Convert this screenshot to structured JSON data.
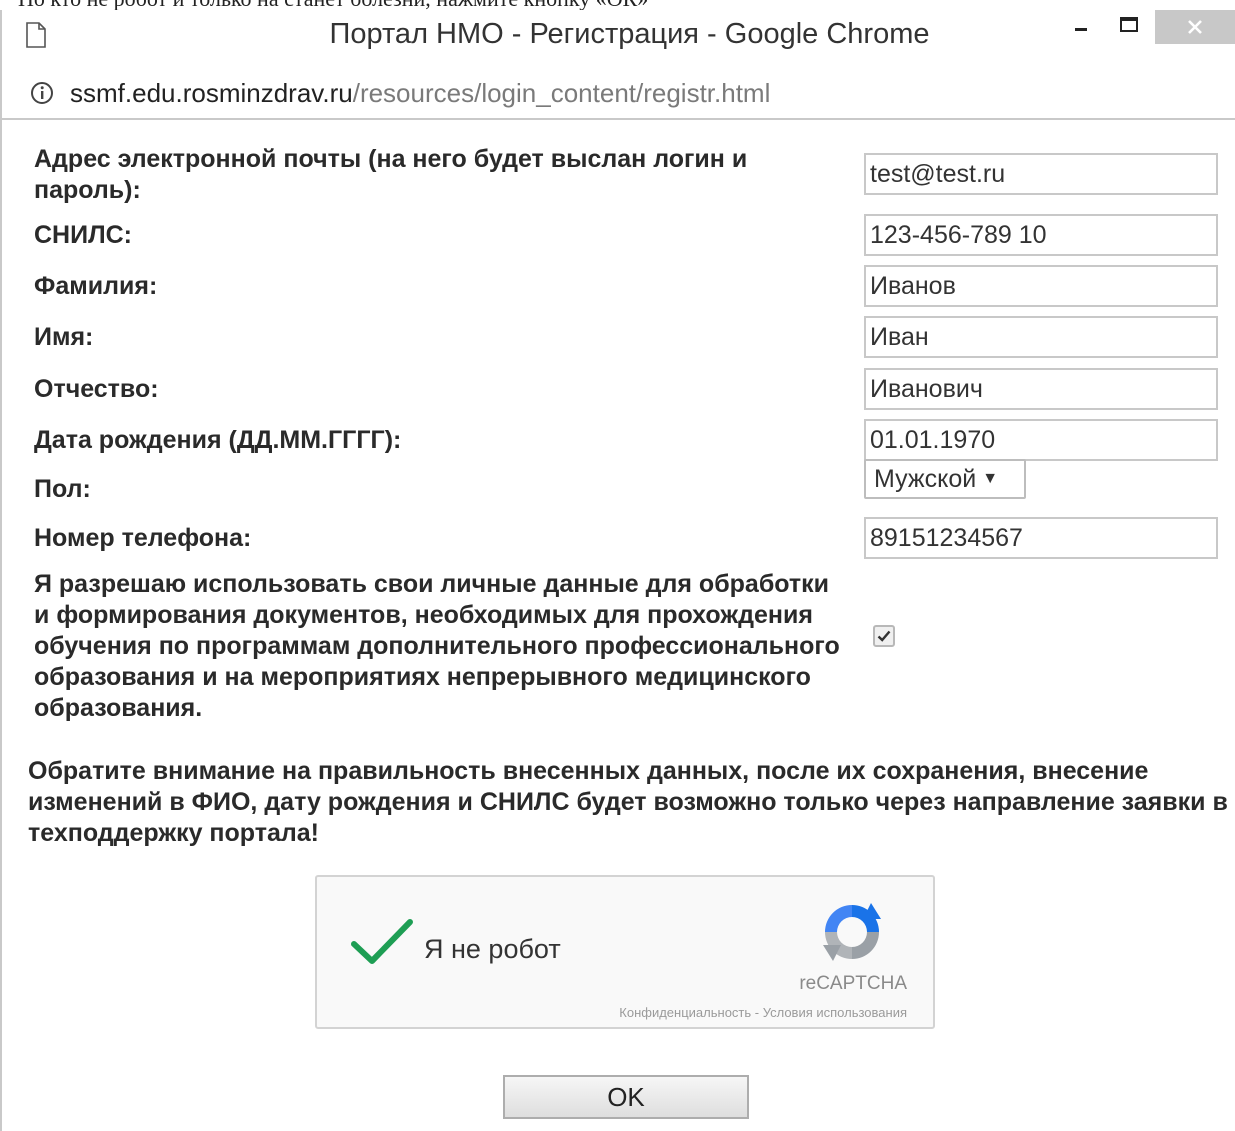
{
  "top_snippet": "Но кто не робот и только на станет болезни, нажмите кнопку «ОК»",
  "window": {
    "title": "Портал НМО - Регистрация - Google Chrome"
  },
  "address_bar": {
    "host": "ssmf.edu.rosminzdrav.ru",
    "path": "/resources/login_content/registr.html"
  },
  "form": {
    "fields": [
      {
        "label": "Адрес электронной почты (на него будет выслан логин и пароль):",
        "value": "test@test.ru"
      },
      {
        "label": "СНИЛС:",
        "value": "123-456-789 10"
      },
      {
        "label": "Фамилия:",
        "value": "Иванов"
      },
      {
        "label": "Имя:",
        "value": "Иван"
      },
      {
        "label": "Отчество:",
        "value": "Иванович"
      },
      {
        "label": "Дата рождения (ДД.ММ.ГГГГ):",
        "value": "01.01.1970"
      }
    ],
    "gender": {
      "label": "Пол:",
      "selected": "Мужской",
      "caret": "▼"
    },
    "phone": {
      "label": "Номер телефона:",
      "value": "89151234567"
    },
    "consent": {
      "text": "Я разрешаю использовать свои личные данные для обработки и формирования документов, необходимых для прохождения обучения по программам дополнительного профессионального образования и на мероприятиях непрерывного медицинского образования.",
      "checked": true
    },
    "notice": "Обратите внимание на правильность внесенных данных, после их сохранения, внесение изменений в ФИО, дату рождения и СНИЛС будет возможно только через направление заявки в техподдержку портала!"
  },
  "captcha": {
    "label": "Я не робот",
    "brand": "reCAPTCHA",
    "links": "Конфиденциальность - Условия использования",
    "check_color": "#1e9e54"
  },
  "ok_button": {
    "label": "OK"
  }
}
